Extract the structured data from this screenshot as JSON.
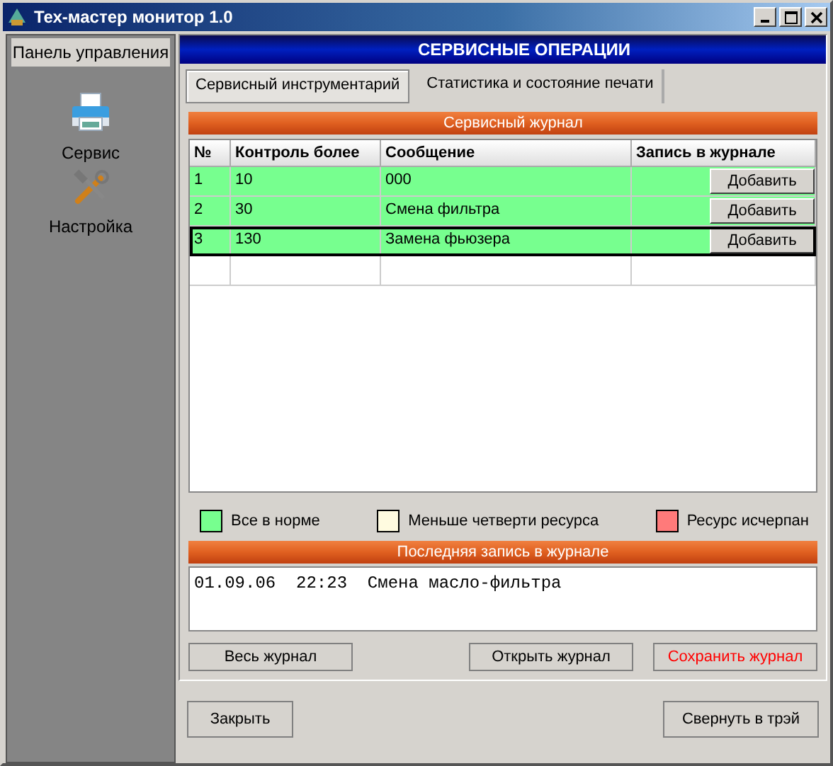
{
  "window": {
    "title": "Тех-мастер монитор 1.0"
  },
  "sidebar": {
    "title": "Панель управления",
    "items": [
      {
        "label": "Сервис",
        "kind": "printer"
      },
      {
        "label": "Настройка",
        "kind": "tools"
      }
    ]
  },
  "header": "СЕРВИСНЫЕ ОПЕРАЦИИ",
  "tabs": [
    {
      "label": "Сервисный инструментарий",
      "selected": true
    },
    {
      "label": "Статистика и состояние печати",
      "selected": false
    }
  ],
  "journal": {
    "title": "Сервисный журнал",
    "columns": [
      "№",
      "Контроль более",
      "Сообщение",
      "Запись в журнале"
    ],
    "rows": [
      {
        "no": "1",
        "limit": "10",
        "message": "000",
        "action": "Добавить",
        "color": "#77ff8f",
        "selected": false
      },
      {
        "no": "2",
        "limit": "30",
        "message": "Смена фильтра",
        "action": "Добавить",
        "color": "#77ff8f",
        "selected": false
      },
      {
        "no": "3",
        "limit": "130",
        "message": "Замена фьюзера",
        "action": "Добавить",
        "color": "#77ff8f",
        "selected": true
      }
    ]
  },
  "legend": [
    {
      "label": "Все в норме",
      "color": "#77ff8f"
    },
    {
      "label": "Меньше четверти ресурса",
      "color": "#fffbe0"
    },
    {
      "label": "Ресурс исчерпан",
      "color": "#ff7a7a"
    }
  ],
  "last_entry": {
    "title": "Последняя запись в журнале",
    "text": "01.09.06  22:23  Смена масло-фильтра"
  },
  "log_buttons": [
    {
      "label": "Весь журнал",
      "kind": "normal"
    },
    {
      "label": "Открыть журнал",
      "kind": "normal"
    },
    {
      "label": "Сохранить журнал",
      "kind": "warning"
    }
  ],
  "footer_buttons": [
    "Закрыть",
    "Свернуть в трэй"
  ]
}
